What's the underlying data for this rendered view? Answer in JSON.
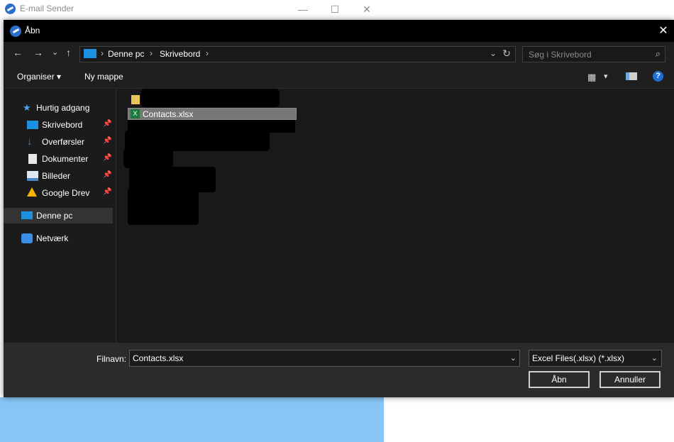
{
  "parent_window": {
    "title": "E-mail Sender",
    "minimize": "—",
    "maximize": "☐",
    "close": "✕",
    "accent": "#87c5f5"
  },
  "dialog": {
    "title": "Åbn",
    "close": "✕",
    "nav": {
      "back": "←",
      "forward": "→",
      "recent": "⌄",
      "up": "↑",
      "breadcrumb": [
        "Denne pc",
        "Skrivebord"
      ],
      "breadcrumb_sep": "›",
      "dropdown": "⌄",
      "refresh": "↻"
    },
    "search": {
      "placeholder": "Søg i Skrivebord",
      "icon": "⌕"
    },
    "toolbar": {
      "organize": "Organiser ▾",
      "new_folder": "Ny mappe",
      "view_menu": "▾",
      "help": "?"
    },
    "sidebar": {
      "quick_access": "Hurtig adgang",
      "items": [
        {
          "label": "Skrivebord",
          "icon": "desktop-icon"
        },
        {
          "label": "Overførsler",
          "icon": "download-icon"
        },
        {
          "label": "Dokumenter",
          "icon": "document-icon"
        },
        {
          "label": "Billeder",
          "icon": "pictures-icon"
        },
        {
          "label": "Google Drev",
          "icon": "google-drive-icon"
        }
      ],
      "pin": "📌",
      "this_pc": "Denne pc",
      "network": "Netværk"
    },
    "files": {
      "selected": "Contacts.xlsx",
      "excel_badge": "X"
    },
    "bottom": {
      "filename_label": "Filnavn:",
      "filename_value": "Contacts.xlsx",
      "filetype_value": "Excel Files(.xlsx) (*.xlsx)",
      "chevron": "⌄",
      "open_button": "Åbn",
      "cancel_button": "Annuller"
    }
  }
}
